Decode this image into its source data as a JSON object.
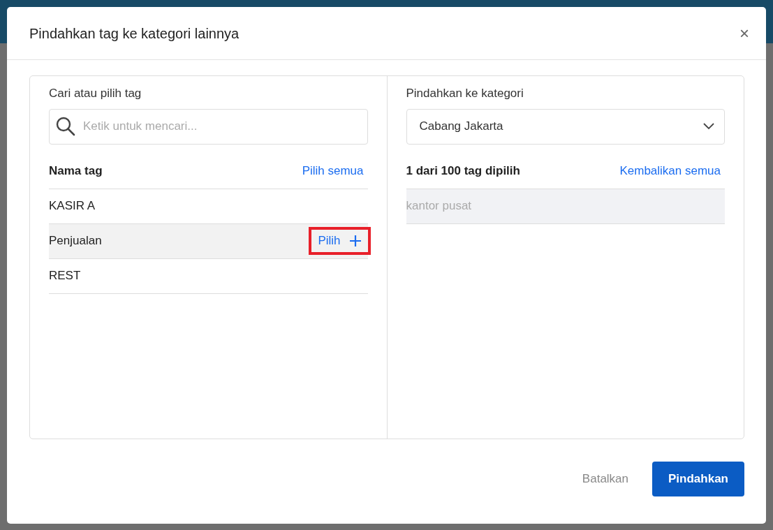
{
  "dialog": {
    "title": "Pindahkan tag ke kategori lainnya",
    "close": "×"
  },
  "source": {
    "label": "Cari atau pilih tag",
    "search": {
      "placeholder": "Ketik untuk mencari..."
    },
    "column": "Nama tag",
    "select_all": "Pilih semua",
    "rows": [
      {
        "name": "KASIR A",
        "hovered": false
      },
      {
        "name": "Penjualan",
        "hovered": true,
        "action": "Pilih",
        "highlighted": true
      },
      {
        "name": "REST",
        "hovered": false
      }
    ]
  },
  "target": {
    "label": "Pindahkan ke kategori",
    "category": "Cabang Jakarta",
    "summary": "1 dari 100 tag dipilih",
    "restore_all": "Kembalikan semua",
    "rows": [
      {
        "name": "kantor pusat",
        "disabled": true
      }
    ]
  },
  "buttons": [
    {
      "label": "Batalkan",
      "kind": "secondary"
    },
    {
      "label": "Pindahkan",
      "kind": "primary"
    }
  ]
}
